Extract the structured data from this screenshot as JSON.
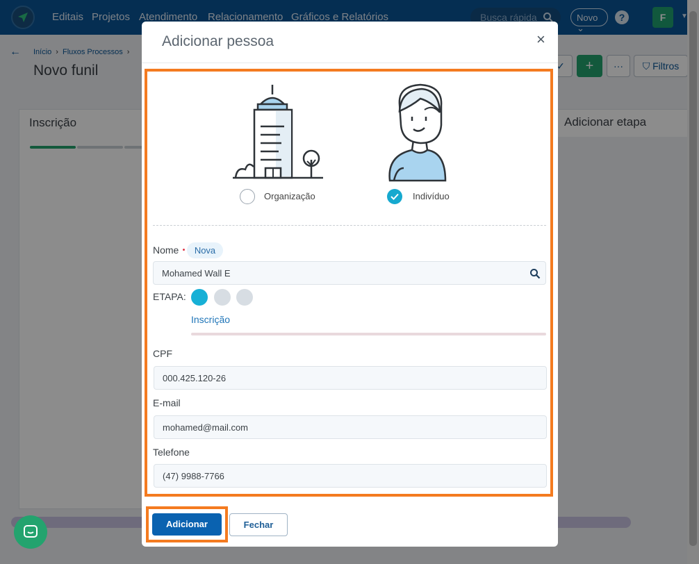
{
  "nav": {
    "items": [
      "Editais",
      "Projetos",
      "Atendimento",
      "Relacionamento",
      "Gráficos e Relatórios"
    ],
    "search_placeholder": "Busca rápida",
    "new_label": "Novo",
    "help_label": "?",
    "avatar_initial": "F"
  },
  "page": {
    "breadcrumb": [
      "Início",
      "Fluxos Processos"
    ],
    "title": "Novo funil",
    "filters_label": "Filtros",
    "add_label": "+",
    "more_label": "···",
    "columns": [
      {
        "title": "Inscrição"
      },
      {
        "title": "Adicionar etapa"
      }
    ]
  },
  "modal": {
    "title": "Adicionar pessoa",
    "close_label": "×",
    "types": [
      {
        "label": "Organização",
        "selected": false
      },
      {
        "label": "Indivíduo",
        "selected": true
      }
    ],
    "name": {
      "label": "Nome",
      "tag": "Nova",
      "value": "Mohamed Wall E"
    },
    "stage": {
      "label": "ETAPA:",
      "current": "Inscrição",
      "steps_total": 3,
      "current_step": 1
    },
    "cpf": {
      "label": "CPF",
      "value": "000.425.120-26"
    },
    "email": {
      "label": "E-mail",
      "value": "mohamed@mail.com"
    },
    "phone": {
      "label": "Telefone",
      "value": "(47) 9988-7766"
    },
    "add_button": "Adicionar",
    "close_button": "Fechar"
  },
  "colors": {
    "nav_bg": "#0a5596",
    "primary": "#0a62b0",
    "accent_check": "#16a9cf",
    "success": "#23a36e",
    "highlight": "#f47b20"
  }
}
